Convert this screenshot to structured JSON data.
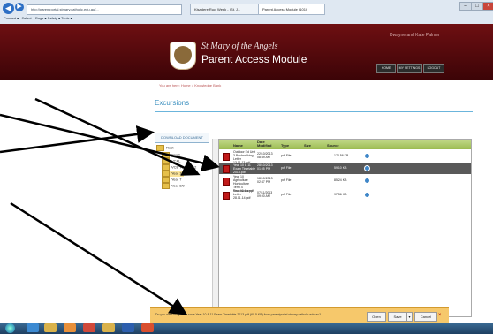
{
  "browser": {
    "address": "http://parentportal.stmary.catholic.edu.au/...",
    "tabs": [
      "Kisadere Ruci Week - (St. J...",
      "Parent Access Module (101)"
    ],
    "commands": {
      "convert": "Convert",
      "select": "Select",
      "page": "Page",
      "safety": "Safety",
      "tools": "Tools"
    }
  },
  "header": {
    "school": "St Mary of the Angels",
    "module": "Parent Access Module",
    "user": "Dwayne and Kate Palmer",
    "buttons": [
      "HOME",
      "MY SETTINGS",
      "LOGOUT"
    ]
  },
  "breadcrumb": "You are here: Home > Knowledge Bank",
  "page_title": "Excursions",
  "download_button": "DOWNLOAD DOCUMENT",
  "tree": {
    "root": "Root",
    "items": [
      "Sport",
      "VCAL",
      "VCE Year 11-12",
      "Year 10",
      "Year 7",
      "Year 8/9"
    ],
    "selected_index": 3
  },
  "files": {
    "columns": [
      "Name",
      "Date Modified",
      "Type",
      "Size",
      "Source"
    ],
    "rows": [
      {
        "name": "Outdoor Ed Unit 3 Bushwalking Letter 13.11.13.pdf",
        "date": "22/10/2013 08:49 AM",
        "type": "pdf File",
        "size": "174.56 KB"
      },
      {
        "name": "Year 10 & 11 Exam Timetable 2013.pdf",
        "date": "28/10/2013 01:05 PM",
        "type": "pdf File",
        "size": "59.10 KB"
      },
      {
        "name": "Year 10 Agriculture Horticulture Term 4 Excursions.pdf",
        "date": "18/10/2013 02:47 PM",
        "type": "pdf File",
        "size": "85.24 KB"
      },
      {
        "name": "Year 11 Camp Letter 28.01.14.pdf",
        "date": "07/11/2013 09:00 AM",
        "type": "pdf File",
        "size": "97.56 KB"
      }
    ],
    "highlighted_index": 1
  },
  "notification": {
    "text": "Do you want to open or save Year 10 & 11 Exam Timetable 2013.pdf (60.5 KB) from parentportal.stmary.catholic.edu.au?",
    "buttons": [
      "Open",
      "Save",
      "Cancel"
    ]
  },
  "colors": {
    "header": "#5a0a0d",
    "accent": "#3a8fbf",
    "notification": "#f6c86b",
    "table_header": "#9bbb51"
  }
}
